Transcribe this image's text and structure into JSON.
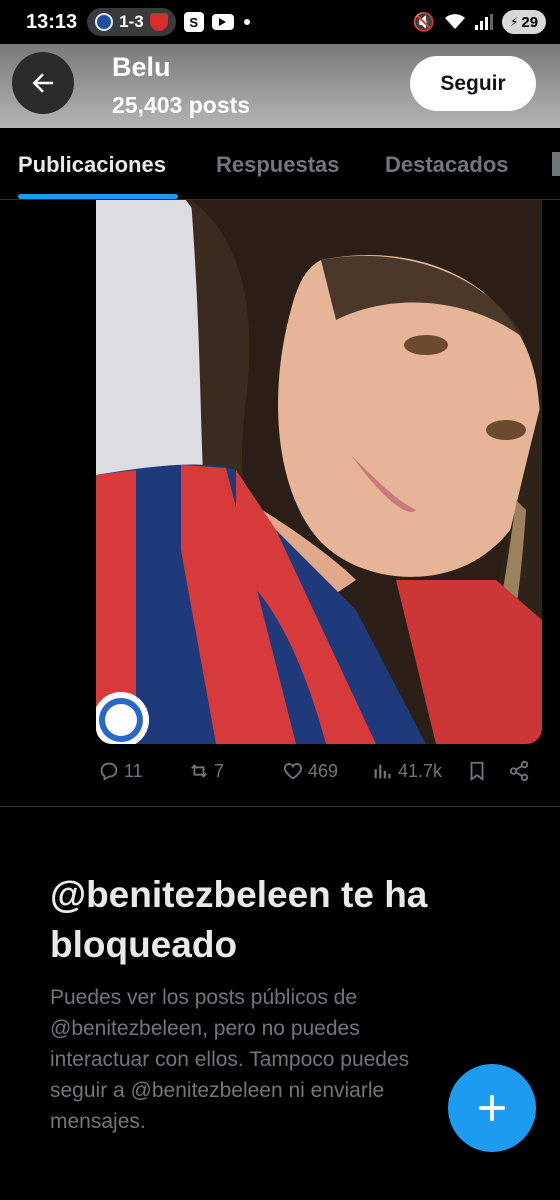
{
  "status_bar": {
    "time": "13:13",
    "score": "1-3",
    "battery": "29"
  },
  "header": {
    "name": "Belu",
    "posts_count": "25,403 posts",
    "follow_label": "Seguir"
  },
  "tabs": [
    {
      "label": "Publicaciones",
      "active": true
    },
    {
      "label": "Respuestas",
      "active": false
    },
    {
      "label": "Destacados",
      "active": false
    }
  ],
  "post": {
    "image_icon": "profile-photo",
    "actions": {
      "replies": "11",
      "reposts": "7",
      "likes": "469",
      "views": "41.7k"
    }
  },
  "blocked_notice": {
    "title": "@benitezbeleen te ha bloqueado",
    "body": "Puedes ver los posts públicos de @benitezbeleen, pero no puedes interactuar con ellos. Tampoco puedes seguir a @benitezbeleen ni enviarle mensajes."
  },
  "colors": {
    "accent": "#1d9bf0",
    "muted_text": "#71767b",
    "background": "#000000"
  }
}
